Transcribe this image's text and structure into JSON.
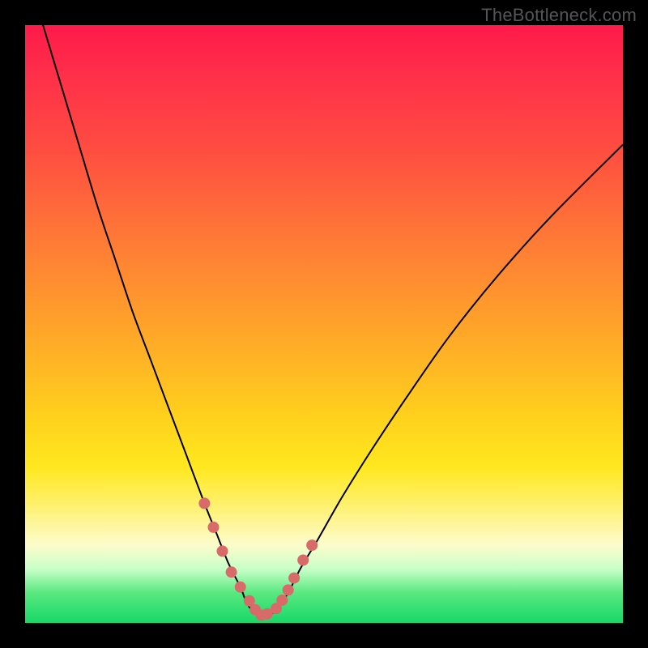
{
  "watermark": "TheBottleneck.com",
  "colors": {
    "background": "#000000",
    "curve": "#000000",
    "marker": "#d86a6a",
    "optimal": "#18d868"
  },
  "chart_data": {
    "type": "line",
    "title": "",
    "xlabel": "",
    "ylabel": "",
    "xlim": [
      0,
      100
    ],
    "ylim": [
      0,
      100
    ],
    "grid": false,
    "legend": false,
    "series": [
      {
        "name": "bottleneck-curve",
        "x": [
          0,
          3,
          6,
          9,
          12,
          15,
          18,
          21,
          24,
          27,
          30,
          32,
          34,
          36,
          37,
          38,
          39,
          40,
          41,
          42,
          44,
          46,
          49,
          53,
          58,
          64,
          71,
          79,
          88,
          100
        ],
        "y": [
          110,
          100,
          90,
          80,
          70,
          61,
          52,
          44,
          36,
          28,
          20,
          15,
          10,
          6,
          3.5,
          2,
          1.2,
          1,
          1.4,
          2.2,
          5,
          9,
          14,
          21,
          29,
          38,
          48,
          58,
          68,
          80
        ]
      }
    ],
    "markers": {
      "name": "optimal-region",
      "x": [
        30,
        31.5,
        33,
        34.5,
        36,
        37.5,
        38.5,
        39.5,
        40.5,
        42,
        43,
        44,
        45,
        46.5,
        48
      ],
      "y": [
        20,
        16,
        12,
        8.5,
        6,
        3.7,
        2.2,
        1.3,
        1.5,
        2.4,
        3.8,
        5.5,
        7.5,
        10.5,
        13
      ]
    }
  }
}
